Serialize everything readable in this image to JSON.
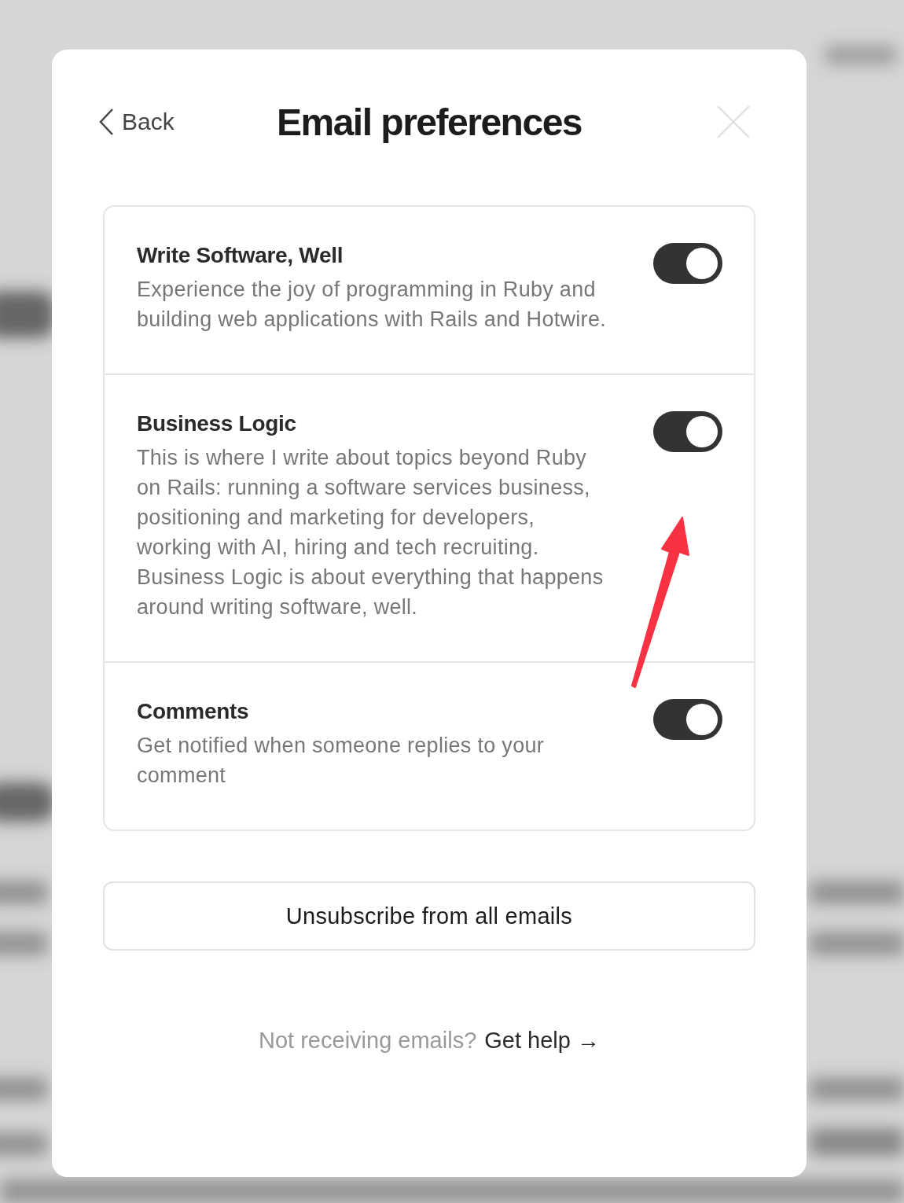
{
  "header": {
    "back": "Back",
    "title": "Email preferences"
  },
  "lists": [
    {
      "name": "Write Software, Well",
      "description": "Experience the joy of programming in Ruby and building web applications with Rails and Hotwire.",
      "on": true
    },
    {
      "name": "Business Logic",
      "description": "This is where I write about topics beyond Ruby on Rails: running a software services business, positioning and marketing for developers, working with AI, hiring and tech recruiting. Business Logic is about everything that happens around writing software, well.",
      "on": true
    },
    {
      "name": "Comments",
      "description": "Get notified when someone replies to your comment",
      "on": true
    }
  ],
  "unsubscribe_button": "Unsubscribe from all emails",
  "footer": {
    "text": "Not receiving emails?",
    "link": "Get help →"
  }
}
